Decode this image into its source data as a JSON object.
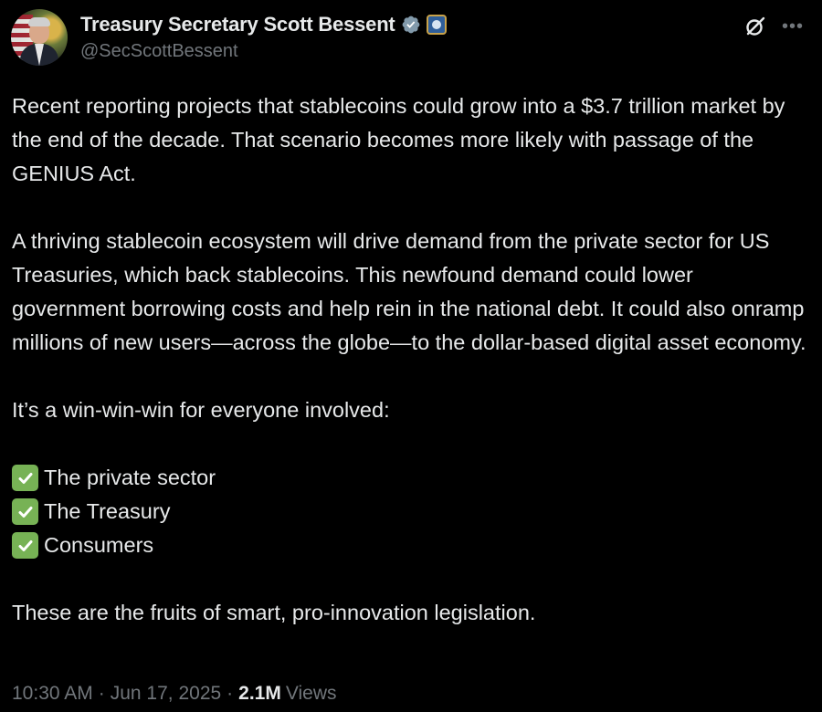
{
  "author": {
    "display_name": "Treasury Secretary Scott Bessent",
    "handle": "@SecScottBessent"
  },
  "icons": {
    "verified": "verified-badge-icon",
    "affiliation": "treasury-seal-icon",
    "grok": "grok-icon",
    "more": "more-options-icon",
    "check": "check-mark-icon"
  },
  "colors": {
    "background": "#000000",
    "text": "#e7e9ea",
    "muted": "#71767b",
    "check_green": "#77b255"
  },
  "tweet": {
    "paragraph_1": "Recent reporting projects that stablecoins could grow into a $3.7 trillion market by the end of the decade. That scenario becomes more likely with passage of the GENIUS Act.",
    "paragraph_2": "A thriving stablecoin ecosystem will drive demand from the private sector for US Treasuries, which back stablecoins. This newfound demand could lower government borrowing costs and help rein in the national debt. It could also onramp millions of new users—across the globe—to the dollar-based digital asset economy.",
    "paragraph_3": "It’s a win-win-win for everyone involved:",
    "checklist": [
      "The private sector",
      "The Treasury",
      "Consumers"
    ],
    "paragraph_4": "These are the fruits of smart, pro-innovation legislation."
  },
  "meta": {
    "time": "10:30 AM",
    "separator": "·",
    "date": "Jun 17, 2025",
    "views_count": "2.1M",
    "views_label": "Views"
  }
}
